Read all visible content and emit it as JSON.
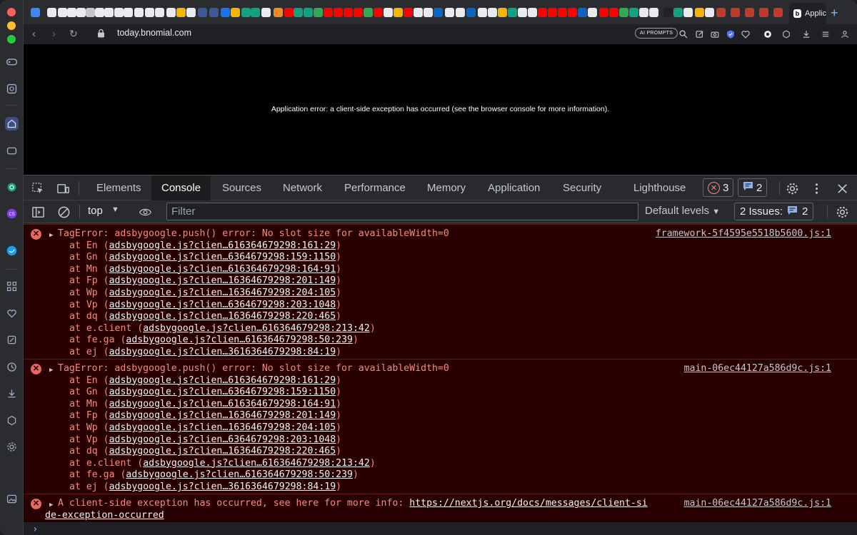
{
  "browser": {
    "url": "today.bnomial.com",
    "active_tab_label": "Applic",
    "ai_prompts_label": "AI PROMPTS"
  },
  "page": {
    "error_text": "Application error: a client-side exception has occurred (see the browser console for more information)."
  },
  "devtools": {
    "tabs": [
      "Elements",
      "Console",
      "Sources",
      "Network",
      "Performance",
      "Memory",
      "Application",
      "Security",
      "Lighthouse"
    ],
    "active_tab": "Console",
    "error_count": "3",
    "message_count": "2",
    "context": "top",
    "filter_placeholder": "Filter",
    "levels_label": "Default levels",
    "issues_label": "2 Issues:",
    "issues_count": "2"
  },
  "console": {
    "messages": [
      {
        "text": "TagError: adsbygoogle.push() error: No slot size for availableWidth=0",
        "source": "framework-5f4595e5518b5600.js:1",
        "frames": [
          {
            "prefix": "at En (",
            "link": "adsbygoogle.js?clien…616364679298:161:29",
            "suffix": ")"
          },
          {
            "prefix": "at Gn (",
            "link": "adsbygoogle.js?clien…6364679298:159:1150",
            "suffix": ")"
          },
          {
            "prefix": "at Mn (",
            "link": "adsbygoogle.js?clien…616364679298:164:91",
            "suffix": ")"
          },
          {
            "prefix": "at Fp (",
            "link": "adsbygoogle.js?clien…16364679298:201:149",
            "suffix": ")"
          },
          {
            "prefix": "at Wp (",
            "link": "adsbygoogle.js?clien…16364679298:204:105",
            "suffix": ")"
          },
          {
            "prefix": "at Vp (",
            "link": "adsbygoogle.js?clien…6364679298:203:1048",
            "suffix": ")"
          },
          {
            "prefix": "at dq (",
            "link": "adsbygoogle.js?clien…16364679298:220:465",
            "suffix": ")"
          },
          {
            "prefix": "at e.client (",
            "link": "adsbygoogle.js?clien…616364679298:213:42",
            "suffix": ")"
          },
          {
            "prefix": "at fe.ga (",
            "link": "adsbygoogle.js?clien…616364679298:50:239",
            "suffix": ")"
          },
          {
            "prefix": "at ej (",
            "link": "adsbygoogle.js?clien…3616364679298:84:19",
            "suffix": ")"
          }
        ]
      },
      {
        "text": "TagError: adsbygoogle.push() error: No slot size for availableWidth=0",
        "source": "main-06ec44127a586d9c.js:1",
        "frames": [
          {
            "prefix": "at En (",
            "link": "adsbygoogle.js?clien…616364679298:161:29",
            "suffix": ")"
          },
          {
            "prefix": "at Gn (",
            "link": "adsbygoogle.js?clien…6364679298:159:1150",
            "suffix": ")"
          },
          {
            "prefix": "at Mn (",
            "link": "adsbygoogle.js?clien…616364679298:164:91",
            "suffix": ")"
          },
          {
            "prefix": "at Fp (",
            "link": "adsbygoogle.js?clien…16364679298:201:149",
            "suffix": ")"
          },
          {
            "prefix": "at Wp (",
            "link": "adsbygoogle.js?clien…16364679298:204:105",
            "suffix": ")"
          },
          {
            "prefix": "at Vp (",
            "link": "adsbygoogle.js?clien…6364679298:203:1048",
            "suffix": ")"
          },
          {
            "prefix": "at dq (",
            "link": "adsbygoogle.js?clien…16364679298:220:465",
            "suffix": ")"
          },
          {
            "prefix": "at e.client (",
            "link": "adsbygoogle.js?clien…616364679298:213:42",
            "suffix": ")"
          },
          {
            "prefix": "at fe.ga (",
            "link": "adsbygoogle.js?clien…616364679298:50:239",
            "suffix": ")"
          },
          {
            "prefix": "at ej (",
            "link": "adsbygoogle.js?clien…3616364679298:84:19",
            "suffix": ")"
          }
        ]
      },
      {
        "text": "A client-side exception has occurred, see here for more info: ",
        "link_part1": "https://nextjs.org/docs/messages/client-si",
        "link_part2": "de-exception-occurred",
        "source": "main-06ec44127a586d9c.js:1"
      }
    ]
  },
  "colors": {
    "error_bg": "#290000",
    "error_text": "#f28b82",
    "accent": "#8ab4f8"
  }
}
